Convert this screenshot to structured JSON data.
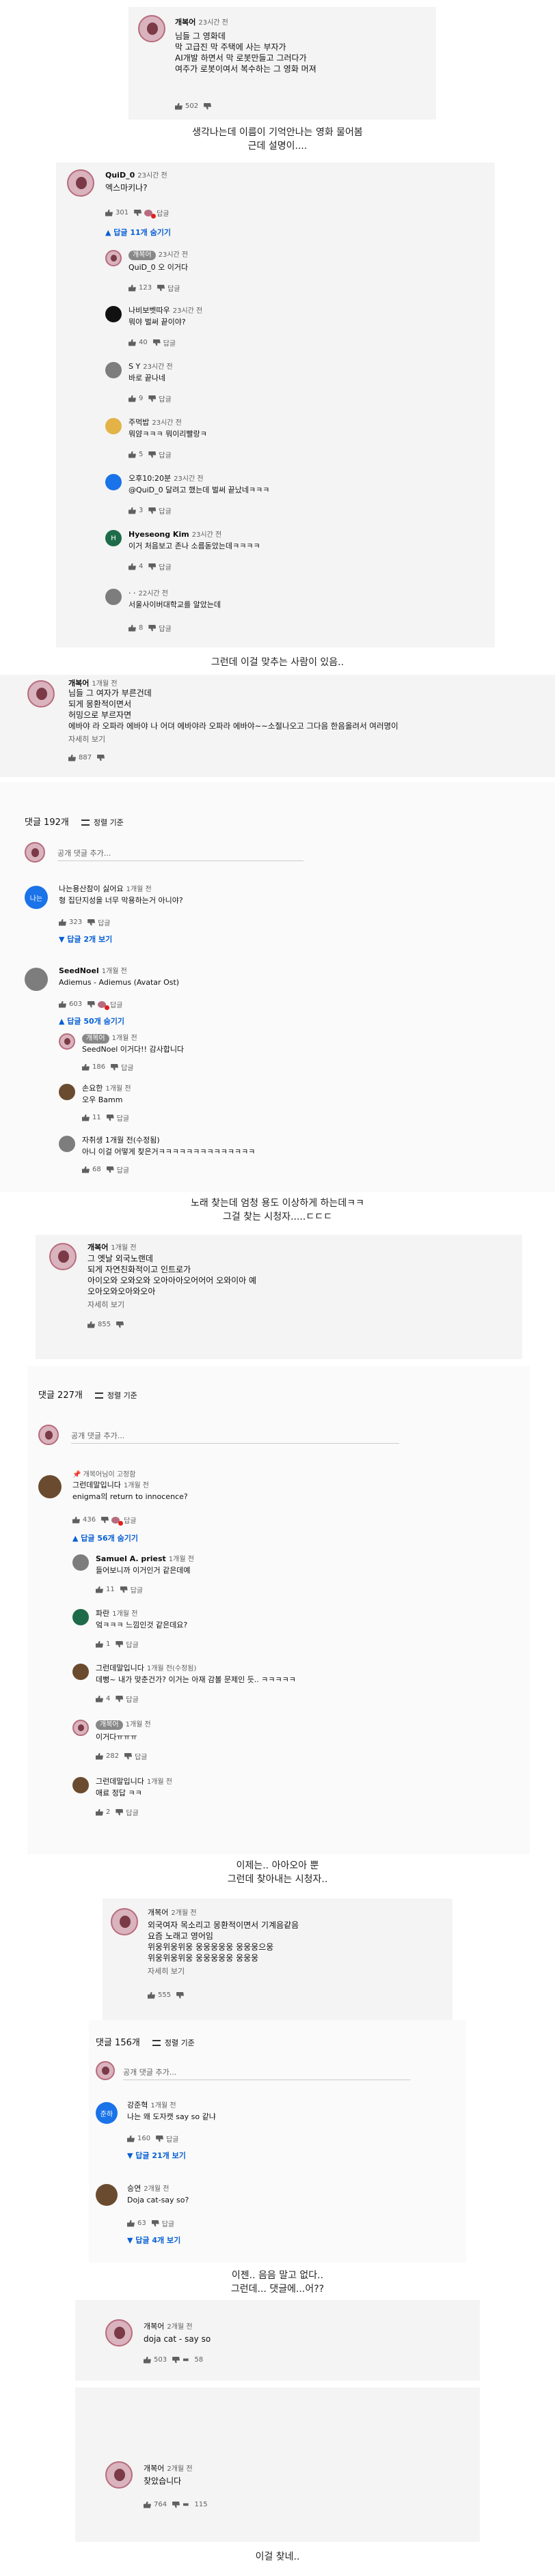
{
  "s1": {
    "name": "개복어",
    "time": "23시간 전",
    "lines": [
      "님들 그 영화데",
      "막 고급진 막 주택에 사는 부자가",
      "AI개발 하면서 막 로봇만들고 그러다가",
      "여주가 로봇이여서 복수하는 그 영화 머져"
    ],
    "likes": "502"
  },
  "cap1": "생각나는데 이름이 기억안나는 영화 물어봄\n근데 설명이....",
  "s2": {
    "top": {
      "name": "QuiD_0",
      "time": "23시간 전",
      "text": "엑스마키나?",
      "likes": "301",
      "reply": "답글",
      "more": "답글 11개 숨기기"
    },
    "replies": [
      {
        "name": "개복어",
        "time": "23시간 전",
        "text": "QuiD_0 오 이거다",
        "likes": "123",
        "reply": "답글"
      },
      {
        "name": "나비보벳따우",
        "time": "23시간 전",
        "text": "뭐야 벌써 끝이야?",
        "likes": "40",
        "reply": "답글"
      },
      {
        "name": "S Y",
        "time": "23시간 전",
        "text": "바로 끝나네",
        "likes": "9",
        "reply": "답글"
      },
      {
        "name": "주먹밥",
        "time": "23시간 전",
        "text": "뭐얌ㅋㅋㅋ 뭐이리빨랑ㅋ",
        "likes": "5",
        "reply": "답글"
      },
      {
        "name": "오후10:20분",
        "time": "23시간 전",
        "text": "@QuiD_0 달려고 했는데 벌써 끝났네ㅋㅋㅋ",
        "likes": "3",
        "reply": "답글"
      },
      {
        "name": "Hyeseong Kim",
        "time": "23시간 전",
        "text": "이거 처음보고 존나 소름돋았는데ㅋㅋㅋㅋ",
        "likes": "4",
        "reply": "답글"
      },
      {
        "name": "· ·",
        "time": "22시간 전",
        "text": "서울사이버대학교를 알았는데",
        "likes": "8",
        "reply": "답글"
      }
    ]
  },
  "cap2": "그런데 이걸 맞추는 사람이 있음..",
  "s3": {
    "name": "개복어",
    "time": "1개월 전",
    "lines": [
      "님들 그 여자가 부른건데",
      "되게 몽환적이면서",
      "허밍으로 부르자면",
      "에바야 라 오파라 에바야 나 어뎌 에바야라 오파라 에바야~~소절나오고 그다음 한음올려서 여러명이"
    ],
    "more": "자세히 보기",
    "likes": "887"
  },
  "s3c": {
    "count": "댓글 192개",
    "sort": "정렬 기준",
    "add": "공개 댓글 추가...",
    "c1": {
      "avatar": "나는",
      "name": "나는용산참이 싫어요",
      "time": "1개월 전",
      "text": "형 집단지성을 너무 막용하는거 아니야?",
      "likes": "323",
      "reply": "답글",
      "more": "답글 2개 보기"
    },
    "c2": {
      "name": "SeedNoel",
      "time": "1개월 전",
      "text": "Adiemus - Adiemus (Avatar Ost)",
      "likes": "603",
      "reply": "답글",
      "more": "답글 50개 숨기기"
    },
    "r1": {
      "tag": "개복어",
      "time": "1개월 전",
      "text": "SeedNoel 이거다!! 감사합니다",
      "likes": "186",
      "reply": "답글"
    },
    "r2": {
      "name": "손요한",
      "time": "1개월 전",
      "text": "오우 Bamm",
      "likes": "11",
      "reply": "답글"
    },
    "r3": {
      "name": "자취생 1개월 전(수정됨)",
      "text": "아니 이걸 어떻게 찾은거ㅋㅋㅋㅋㅋㅋㅋㅋㅋㅋㅋㅋㅋㅋ",
      "likes": "68",
      "reply": "답글"
    }
  },
  "cap3": "노래 찾는데 엄청 용도 이상하게 하는데ㅋㅋ\n그걸 찾는 시청자.....ㄷㄷㄷ",
  "s4": {
    "name": "개복어",
    "time": "1개월 전",
    "lines": [
      "그 옛날 외국노랜데",
      "되게 자연친화적이고 인트로가",
      "아이오와 오와오와 오아아아오어어어 오와이아 예",
      "오아오와오아와오아"
    ],
    "more": "자세히 보기",
    "likes": "855"
  },
  "s4c": {
    "count": "댓글 227개",
    "sort": "정렬 기준",
    "add": "공개 댓글 추가...",
    "pin": "개복어님이 고정함",
    "c1": {
      "name": "그런데말입니다",
      "time": "1개월 전",
      "text": "enigma의 return to innocence?",
      "likes": "436",
      "reply": "답글",
      "more": "답글 56개 숨기기"
    },
    "r": [
      {
        "name": "Samuel A. priest",
        "time": "1개월 전",
        "text": "들어보니까 이거인거 같은데예",
        "likes": "11",
        "reply": "답글"
      },
      {
        "name": "파란",
        "time": "1개월 전",
        "text": "엌ㅋㅋㅋ 느낌인것 같은데요?",
        "likes": "1",
        "reply": "답글"
      },
      {
        "name": "그런데말입니다",
        "time": "1개월 전(수정됨)",
        "text": "데뻥~ 내가 맞춘건가? 이거는 아재 감볼 문제인 듯.. ㅋㅋㅋㅋㅋ",
        "likes": "4",
        "reply": "답글"
      },
      {
        "tag": "개복어",
        "time": "1개월 전",
        "text": "이거다ㅠㅠㅠ",
        "likes": "282",
        "reply": "답글"
      },
      {
        "name": "그런데말입니다",
        "time": "1개월 전",
        "text": "애료 정답 ㅋㅋ",
        "likes": "2",
        "reply": "답글"
      }
    ]
  },
  "cap4": "이제는.. 아아오아 뿐\n그런데 찾아내는 시청자..",
  "s5": {
    "name": "개복어",
    "time": "2개월 전",
    "lines": [
      "외국여자 목소리고 몽환적이면서 기계음같음",
      "요즘 노래고 영어임",
      "위웅위웅위웅 웅웅웅웅웅 웅웅웅으웅",
      "위웅위웅위웅 웅웅웅웅웅 웅웅웅"
    ],
    "more": "자세히 보기",
    "likes": "555"
  },
  "s5c": {
    "count": "댓글 156개",
    "sort": "정렬 기준",
    "add": "공개 댓글 추가...",
    "c1": {
      "avatar": "준하",
      "name": "강준혁",
      "time": "1개월 전",
      "text": "나는 왜 도자캣 say so 같냐",
      "likes": "160",
      "reply": "답글",
      "more": "답글 21개 보기"
    },
    "c2": {
      "name": "승연",
      "time": "2개월 전",
      "text": "Doja cat-say so?",
      "likes": "63",
      "reply": "답글",
      "more": "답글 4개 보기"
    }
  },
  "cap5": "이젠.. 음음 말고 없다..\n그런데... 댓글에...어??",
  "s6": {
    "name": "개복어",
    "time": "2개월 전",
    "text": "doja cat - say so",
    "likes": "503",
    "comments": "58"
  },
  "s7": {
    "name": "개복어",
    "time": "2개월 전",
    "text": "찾았습니다",
    "likes": "764",
    "comments": "115"
  },
  "cap6": "이걸 찾네.."
}
